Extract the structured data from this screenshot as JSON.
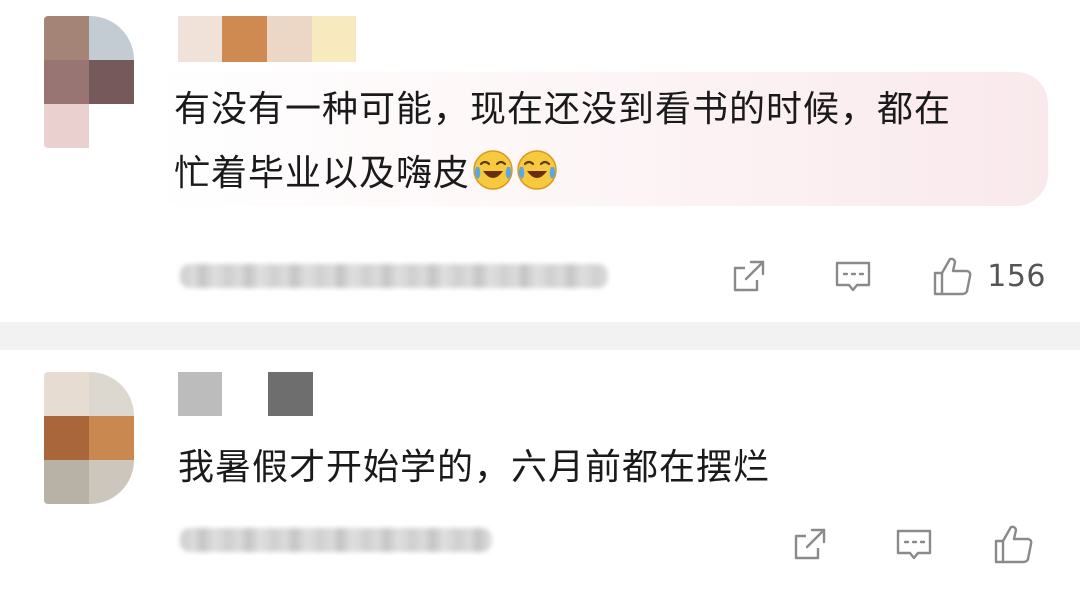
{
  "comments": [
    {
      "text_line_1": "有没有一种可能，现在还没到看书的时候，都在",
      "text_line_2": "忙着毕业以及嗨皮",
      "emoji": [
        "laughing-crying-emoji",
        "laughing-crying-emoji"
      ],
      "like_count": "156",
      "bubble_color": "#f9e9ec"
    },
    {
      "text": "我暑假才开始学的，六月前都在摆烂",
      "like_count": ""
    }
  ],
  "colors": {
    "text": "#1a1a1a",
    "icon": "#8a8a8a",
    "separator": "#f2f2f2",
    "count": "#555555"
  },
  "icons": {
    "share": "share-icon",
    "reply": "reply-icon",
    "like": "thumbs-up-icon"
  }
}
